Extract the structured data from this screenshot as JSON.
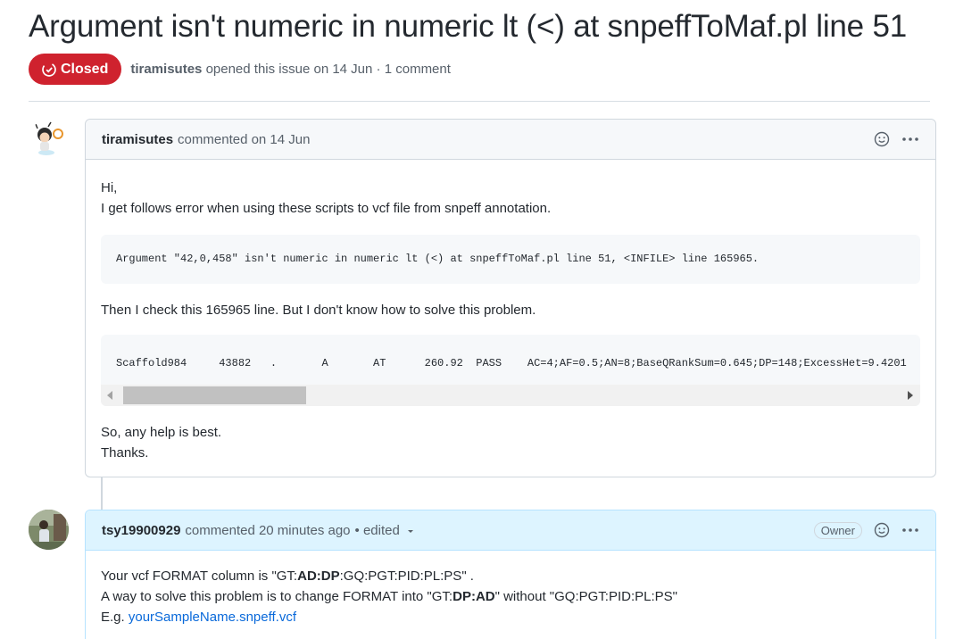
{
  "issue": {
    "title": "Argument isn't numeric in numeric lt (<) at snpeffToMaf.pl line 51",
    "state": "Closed",
    "author": "tiramisutes",
    "opened_text": "opened this issue on 14 Jun",
    "separator": "·",
    "comment_count": "1 comment"
  },
  "comments": [
    {
      "author": "tiramisutes",
      "action": "commented on 14 Jun",
      "body": {
        "greeting": "Hi,",
        "line1": "I get follows error when using these scripts to vcf file from snpeff annotation.",
        "code1": "Argument \"42,0,458\" isn't numeric in numeric lt (<) at snpeffToMaf.pl line 51, <INFILE> line 165965.",
        "line2": "Then I check this 165965 line. But I don't know how to solve this problem.",
        "code2": "Scaffold984     43882   .       A       AT      260.92  PASS    AC=4;AF=0.5;AN=8;BaseQRankSum=0.645;DP=148;ExcessHet=9.4201",
        "line3": "So, any help is best.",
        "line4": "Thanks."
      }
    },
    {
      "author": "tsy19900929",
      "action": "commented 20 minutes ago",
      "edited": "• edited",
      "role_badge": "Owner",
      "body": {
        "l1_pre": "Your vcf FORMAT column is \"GT:",
        "l1_bold": "AD:DP",
        "l1_post": ":GQ:PGT:PID:PL:PS\" .",
        "l2_pre": "A way to solve this problem is to change FORMAT into \"GT:",
        "l2_bold": "DP:AD",
        "l2_post": "\" without \"GQ:PGT:PID:PL:PS\"",
        "l3_pre": "E.g. ",
        "l3_link": "yourSampleName.snpeff.vcf"
      }
    }
  ],
  "colors": {
    "closed": "#cf222e",
    "link": "#0969da",
    "owner_header": "#ddf4ff"
  }
}
